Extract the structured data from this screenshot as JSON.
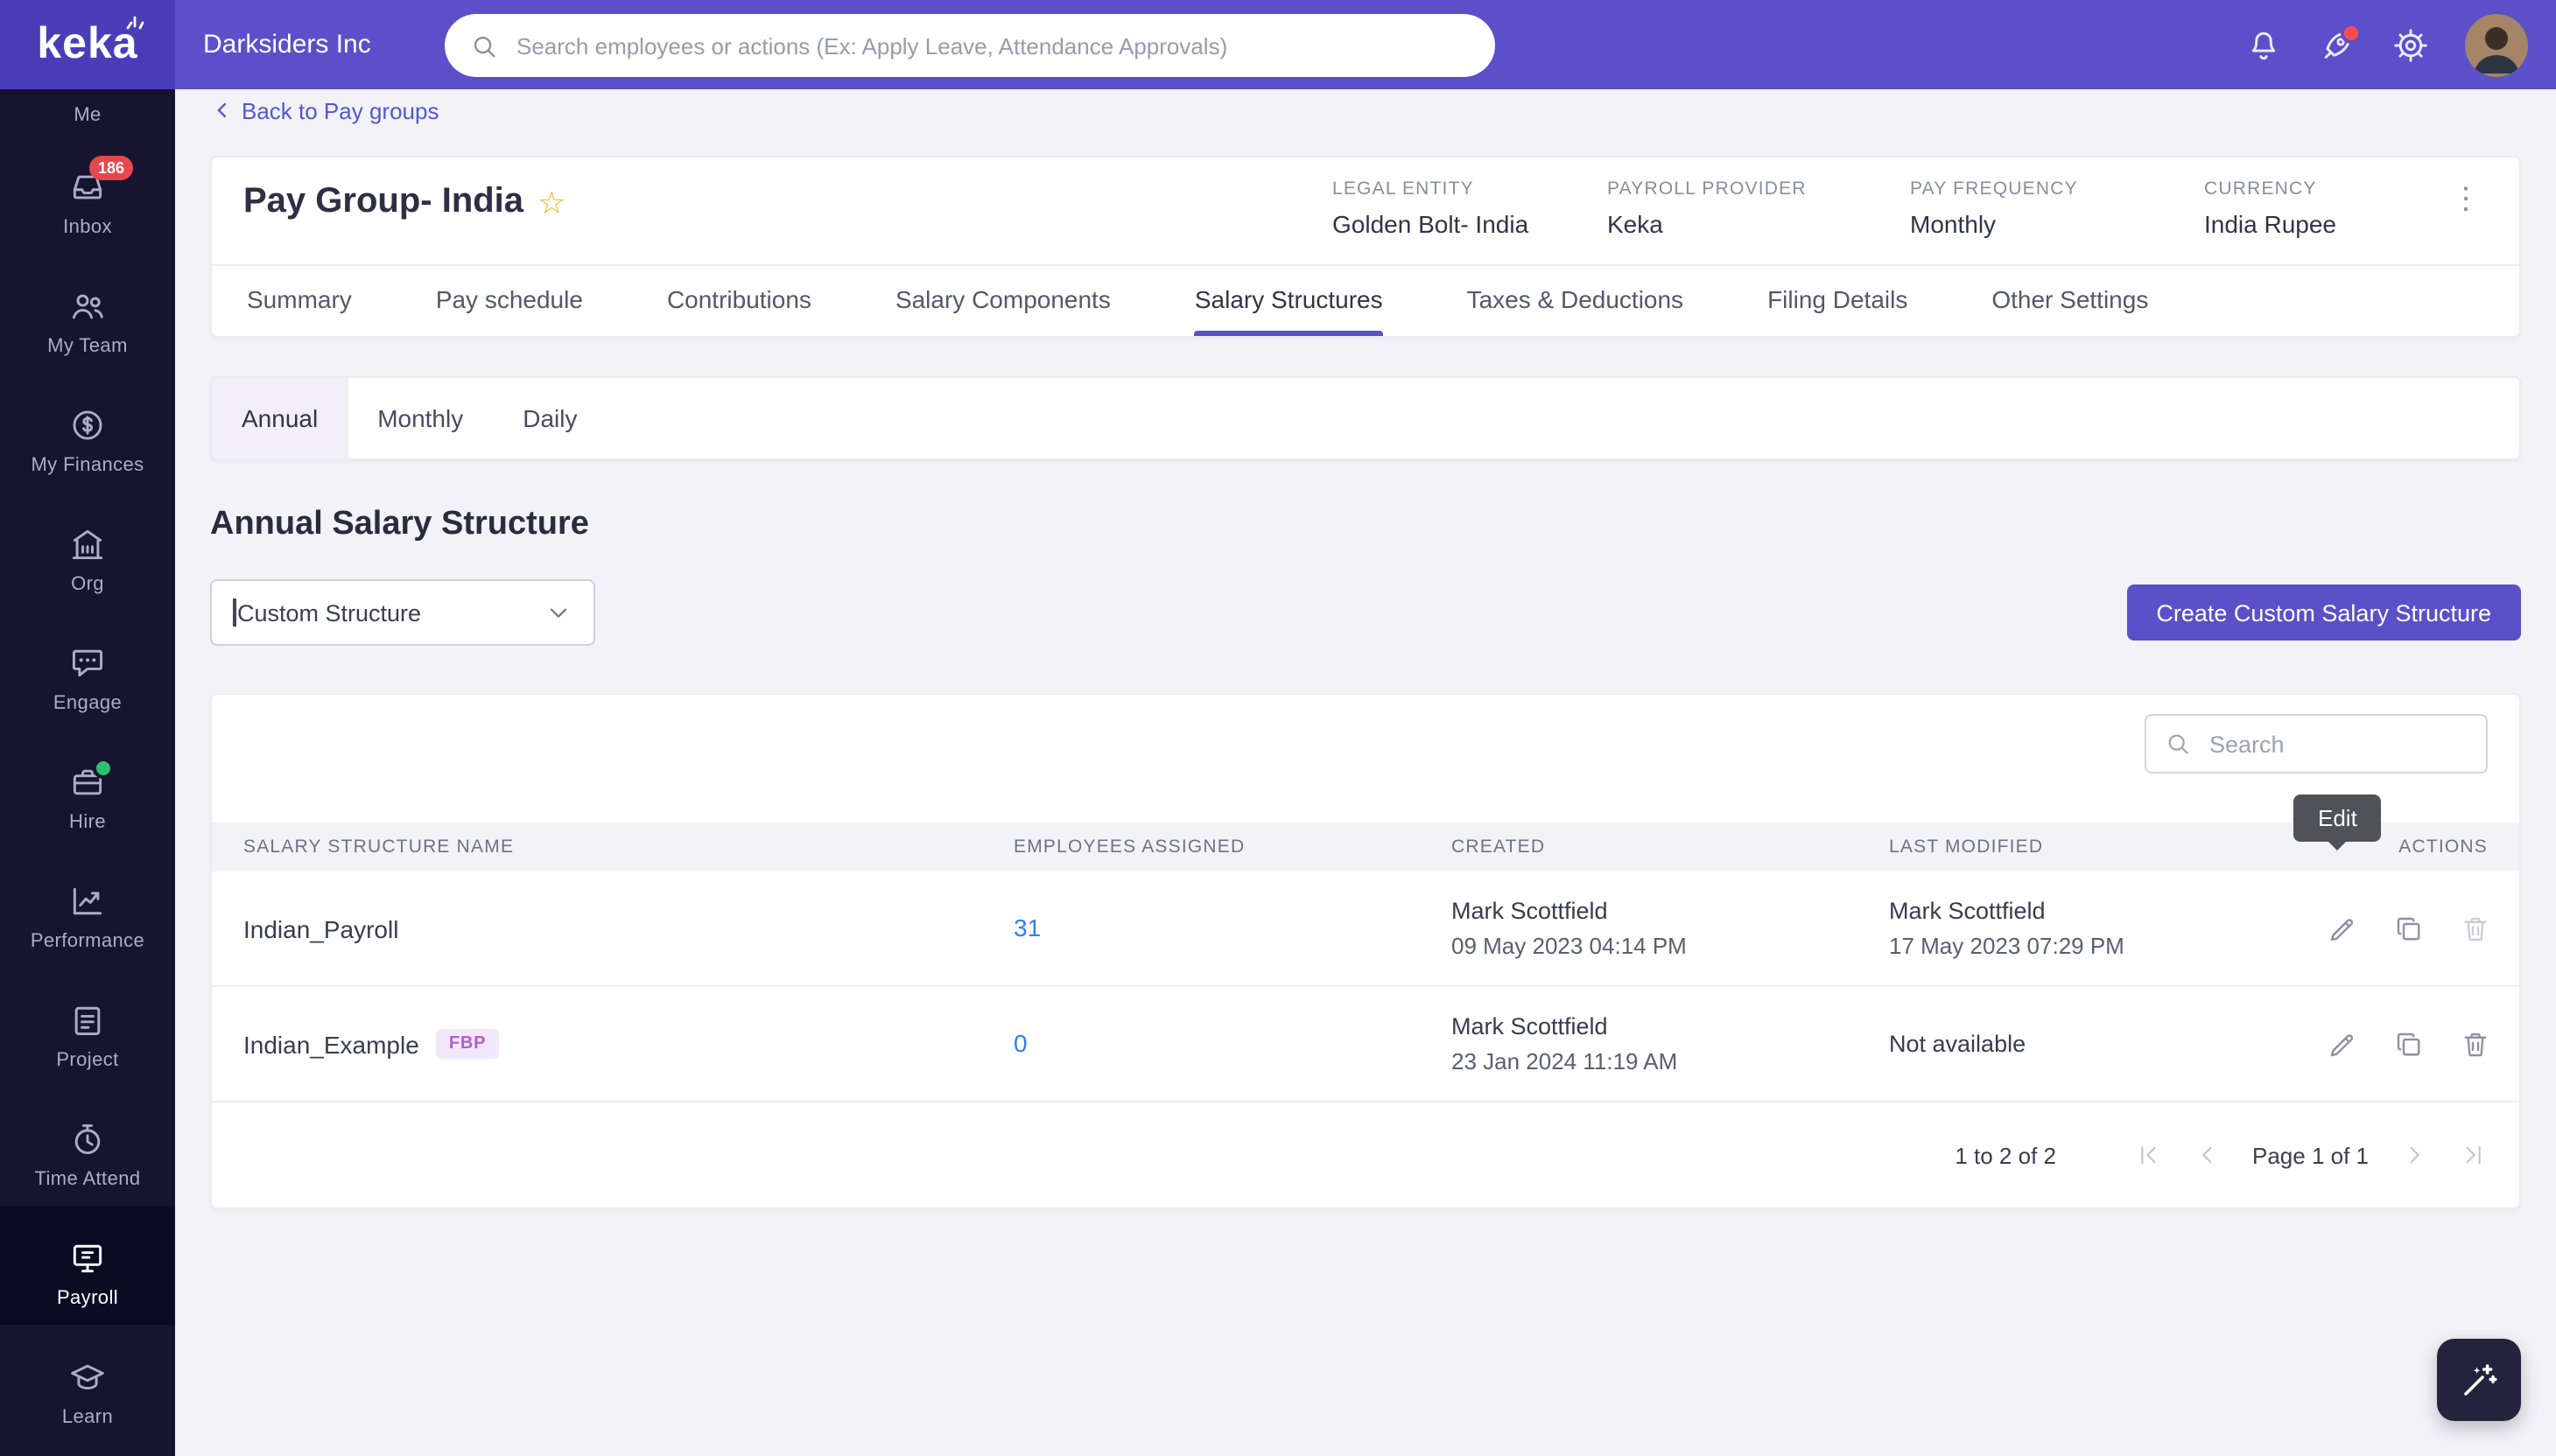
{
  "theme": {
    "accent": "#5a50c8",
    "topbar_bg": "#5b50ca",
    "logo_bg": "#4a3eb8",
    "sidebar_bg": "#16142f",
    "sidebar_active_bg": "#0d0b23",
    "link": "#5059d0",
    "number_link": "#2f80ed",
    "badge_red": "#e5484d",
    "fbp_bg": "#f3e7fb",
    "fbp_text": "#ad5fd3",
    "star": "#f2b01e",
    "tooltip_bg": "#515158",
    "page_bg": "#f2f2f7"
  },
  "topbar": {
    "logo_text": "keka",
    "company_name": "Darksiders Inc",
    "search_placeholder": "Search employees or actions (Ex: Apply Leave, Attendance Approvals)"
  },
  "sidebar": {
    "items": [
      {
        "label": "Me"
      },
      {
        "label": "Inbox",
        "badge": "186"
      },
      {
        "label": "My Team"
      },
      {
        "label": "My Finances"
      },
      {
        "label": "Org"
      },
      {
        "label": "Engage"
      },
      {
        "label": "Hire"
      },
      {
        "label": "Performance"
      },
      {
        "label": "Project"
      },
      {
        "label": "Time Attend"
      },
      {
        "label": "Payroll"
      },
      {
        "label": "Learn"
      }
    ]
  },
  "page": {
    "back_link": "Back to Pay groups",
    "pay_group": {
      "title": "Pay Group- India",
      "fields": [
        {
          "label": "LEGAL ENTITY",
          "value": "Golden Bolt- India"
        },
        {
          "label": "PAYROLL PROVIDER",
          "value": "Keka"
        },
        {
          "label": "PAY FREQUENCY",
          "value": "Monthly"
        },
        {
          "label": "CURRENCY",
          "value": "India Rupee"
        }
      ]
    },
    "tabs": [
      "Summary",
      "Pay schedule",
      "Contributions",
      "Salary Components",
      "Salary Structures",
      "Taxes & Deductions",
      "Filing Details",
      "Other Settings"
    ],
    "sub_tabs": [
      "Annual",
      "Monthly",
      "Daily"
    ],
    "section_title": "Annual Salary Structure",
    "structure_dropdown_value": "Custom Structure",
    "create_button_label": "Create Custom Salary Structure"
  },
  "structures_table": {
    "search_placeholder": "Search",
    "columns": [
      "SALARY STRUCTURE NAME",
      "EMPLOYEES ASSIGNED",
      "CREATED",
      "LAST MODIFIED",
      "ACTIONS"
    ],
    "rows": [
      {
        "name": "Indian_Payroll",
        "employees": "31",
        "created_by": "Mark Scottfield",
        "created_on": "09 May 2023 04:14 PM",
        "modified_by": "Mark Scottfield",
        "modified_on": "17 May 2023 07:29 PM"
      },
      {
        "name": "Indian_Example",
        "badge": "FBP",
        "employees": "0",
        "created_by": "Mark Scottfield",
        "created_on": "23 Jan 2024 11:19 AM",
        "modified": "Not available"
      }
    ],
    "edit_tooltip": "Edit",
    "footer": {
      "range_text": "1 to 2 of 2",
      "page_text": "Page 1 of 1"
    }
  }
}
